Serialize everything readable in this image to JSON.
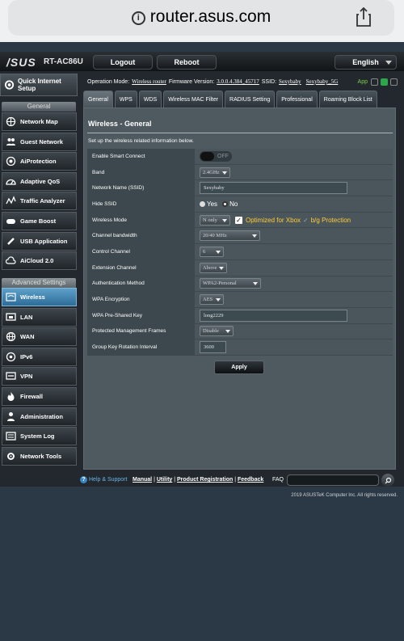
{
  "browser": {
    "url": "router.asus.com"
  },
  "header": {
    "brand": "/SUS",
    "model": "RT-AC86U",
    "logout_label": "Logout",
    "reboot_label": "Reboot",
    "language": "English"
  },
  "sidebar": {
    "quick_setup": "Quick Internet Setup",
    "general_title": "General",
    "advanced_title": "Advanced Settings",
    "general_items": [
      {
        "label": "Network Map",
        "icon": "network-map-icon"
      },
      {
        "label": "Guest Network",
        "icon": "guest-network-icon"
      },
      {
        "label": "AiProtection",
        "icon": "aiprotection-icon"
      },
      {
        "label": "Adaptive QoS",
        "icon": "qos-icon"
      },
      {
        "label": "Traffic Analyzer",
        "icon": "traffic-analyzer-icon"
      },
      {
        "label": "Game Boost",
        "icon": "gamepad-icon"
      },
      {
        "label": "USB Application",
        "icon": "usb-icon"
      },
      {
        "label": "AiCloud 2.0",
        "icon": "cloud-icon"
      }
    ],
    "advanced_items": [
      {
        "label": "Wireless",
        "icon": "wireless-icon",
        "active": true
      },
      {
        "label": "LAN",
        "icon": "lan-icon"
      },
      {
        "label": "WAN",
        "icon": "wan-globe-icon"
      },
      {
        "label": "IPv6",
        "icon": "ipv6-icon"
      },
      {
        "label": "VPN",
        "icon": "vpn-icon"
      },
      {
        "label": "Firewall",
        "icon": "firewall-icon"
      },
      {
        "label": "Administration",
        "icon": "administration-icon"
      },
      {
        "label": "System Log",
        "icon": "system-log-icon"
      },
      {
        "label": "Network Tools",
        "icon": "network-tools-icon"
      }
    ]
  },
  "status": {
    "op_mode_label": "Operation Mode:",
    "op_mode": "Wireless router",
    "fw_label": "Firmware Version:",
    "fw": "3.0.0.4.384_45717",
    "ssid_label": "SSID:",
    "ssid1": "Sexybaby",
    "ssid2": "Sexybaby_5G",
    "app": "App"
  },
  "tabs": [
    "General",
    "WPS",
    "WDS",
    "Wireless MAC Filter",
    "RADIUS Setting",
    "Professional",
    "Roaming Block List"
  ],
  "content": {
    "title": "Wireless - General",
    "description": "Set up the wireless related information below."
  },
  "form": {
    "smart_connect": {
      "label": "Enable Smart Connect",
      "value": "OFF"
    },
    "band": {
      "label": "Band",
      "value": "2.4GHz"
    },
    "ssid": {
      "label": "Network Name (SSID)",
      "value": "Sexybaby"
    },
    "hide_ssid": {
      "label": "Hide SSID",
      "yes": "Yes",
      "no": "No"
    },
    "wireless_mode": {
      "label": "Wireless Mode",
      "value": "N only",
      "optimized": "Optimized for Xbox",
      "bg": "b/g Protection"
    },
    "bandwidth": {
      "label": "Channel bandwidth",
      "value": "20/40 MHz"
    },
    "control_channel": {
      "label": "Control Channel",
      "value": "6"
    },
    "extension_channel": {
      "label": "Extension Channel",
      "value": "Above"
    },
    "auth": {
      "label": "Authentication Method",
      "value": "WPA2-Personal"
    },
    "wpa_enc": {
      "label": "WPA Encryption",
      "value": "AES"
    },
    "psk": {
      "label": "WPA Pre-Shared Key",
      "value": "long2229"
    },
    "pmf": {
      "label": "Protected Management Frames",
      "value": "Disable"
    },
    "gkri": {
      "label": "Group Key Rotation Interval",
      "value": "3600"
    }
  },
  "apply_label": "Apply",
  "footer": {
    "help": "Help & Support",
    "manual": "Manual",
    "utility": "Utility",
    "registration": "Product Registration",
    "feedback": "Feedback",
    "faq": "FAQ",
    "copyright": "2019 ASUSTeK Computer Inc. All rights reserved."
  }
}
